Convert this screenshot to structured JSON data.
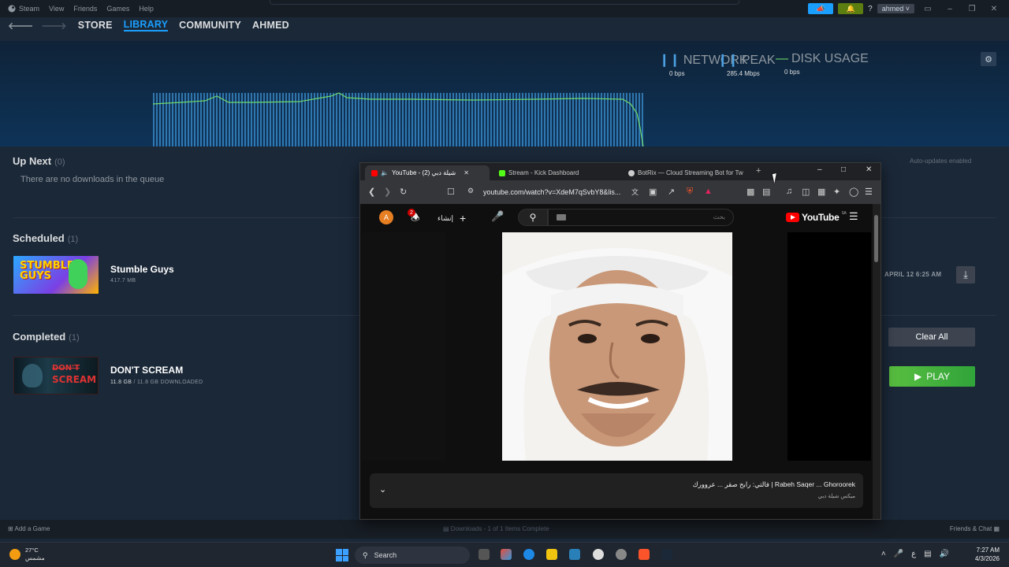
{
  "steam_menubar": {
    "app_name": "Steam",
    "menu": [
      "View",
      "Friends",
      "Games",
      "Help"
    ],
    "account": "ahmed",
    "help": "?"
  },
  "steam_nav": {
    "items": [
      "STORE",
      "LIBRARY",
      "COMMUNITY",
      "AHMED"
    ],
    "active": "LIBRARY"
  },
  "download_stats": {
    "network_label": "NETWORK",
    "network_value": "0 bps",
    "peak_label": "PEAK",
    "peak_value": "285.4 Mbps",
    "disk_label": "DISK USAGE",
    "disk_value": "0 bps"
  },
  "up_next": {
    "title": "Up Next",
    "count": "(0)",
    "empty": "There are no downloads in the queue",
    "auto_updates": "Auto-updates enabled"
  },
  "scheduled": {
    "title": "Scheduled",
    "count": "(1)",
    "game": "Stumble Guys",
    "size": "417.7 MB",
    "time": "APRIL 12 6:25 AM",
    "thumb_text": "STUMBLE GUYS"
  },
  "completed": {
    "title": "Completed",
    "count": "(1)",
    "game": "DON'T SCREAM",
    "size": "11.8 GB",
    "size_total": "/ 11.8 GB DOWNLOADED",
    "clear_all": "Clear All",
    "play": "PLAY",
    "thumb_line1": "DON'T",
    "thumb_line2": "SCREAM"
  },
  "footer": {
    "add_game": "Add a Game",
    "status": "Downloads - 1 of 1 Items Complete",
    "friends": "Friends & Chat"
  },
  "browser": {
    "tabs": [
      {
        "label": "YouTube - شيلة دبي (2)",
        "active": true,
        "color": "#ff0000"
      },
      {
        "label": "Stream - Kick Dashboard",
        "active": false,
        "color": "#53fc18"
      },
      {
        "label": "BotRix — Cloud Streaming Bot for Tw",
        "active": false,
        "color": "#cccccc"
      }
    ],
    "url": "youtube.com/watch?v=XdeM7qSvbY8&lis...",
    "youtube": {
      "avatar": "A",
      "notif_count": "2",
      "create": "إنشاء",
      "search_placeholder": "بحث",
      "logo": "YouTube",
      "region": "SA",
      "now_playing_title": "فالتي: رابح صقر ... عروورك | Rabeh Saqer ... Ghoroorek",
      "now_playing_channel": "ميكس شيلة دبي"
    }
  },
  "taskbar": {
    "temp": "27°C",
    "weather": "مشمس",
    "search": "Search",
    "time": "7:27 AM",
    "date": "4/3/2026",
    "lang": "ع"
  },
  "colors": {
    "steam_bg": "#1b2838",
    "steam_accent": "#1a9fff",
    "play_green": "#5ba32b",
    "yt_red": "#ff0000"
  }
}
